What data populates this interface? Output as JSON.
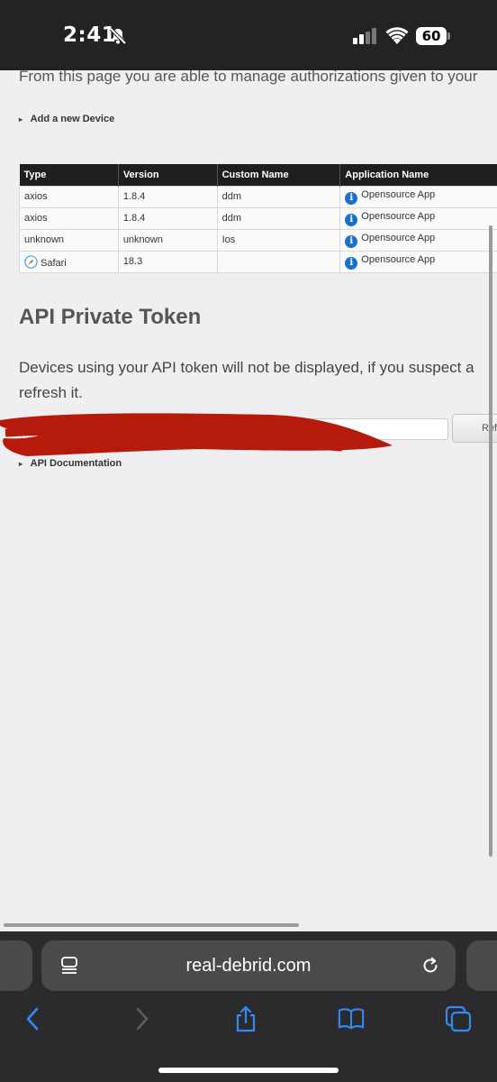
{
  "status_bar": {
    "time": "2:41",
    "battery": "60"
  },
  "page": {
    "intro_text": "From this page you are able to manage authorizations given to your",
    "add_device": "Add a new Device",
    "devices_table": {
      "headers": [
        "Type",
        "Version",
        "Custom Name",
        "Application Name"
      ],
      "rows": [
        {
          "type": "axios",
          "version": "1.8.4",
          "custom_name": "ddm",
          "app_name": "Opensource App"
        },
        {
          "type": "axios",
          "version": "1.8.4",
          "custom_name": "ddm",
          "app_name": "Opensource App"
        },
        {
          "type": "unknown",
          "version": "unknown",
          "custom_name": "Ios",
          "app_name": "Opensource App"
        },
        {
          "type": "Safari",
          "version": "18.3",
          "custom_name": "",
          "app_name": "Opensource App"
        }
      ]
    },
    "api_heading": "API Private Token",
    "api_description": "Devices using your API token will not be displayed, if you suspect a",
    "api_description_2": "refresh it.",
    "refresh_button": "Ref",
    "api_documentation": "API Documentation"
  },
  "browser": {
    "url": "real-debrid.com"
  },
  "colors": {
    "redaction": "#b51a0a",
    "info_icon": "#1a73c9",
    "safari_blue": "#0a84ff"
  }
}
